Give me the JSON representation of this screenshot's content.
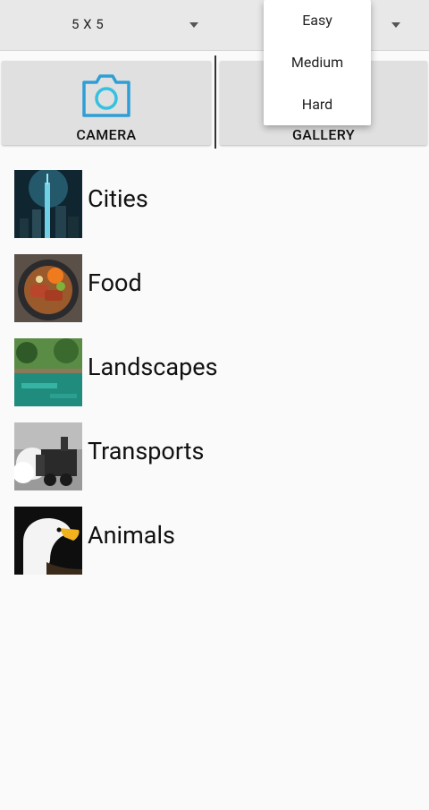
{
  "toolbar": {
    "grid_size_value": "5 X 5"
  },
  "difficulty_menu": {
    "options": [
      "Easy",
      "Medium",
      "Hard"
    ]
  },
  "buttons": {
    "camera_label": "CAMERA",
    "gallery_label": "GALLERY"
  },
  "categories": [
    {
      "label": "Cities",
      "thumb": "cities-thumbnail"
    },
    {
      "label": "Food",
      "thumb": "food-thumbnail"
    },
    {
      "label": "Landscapes",
      "thumb": "landscapes-thumbnail"
    },
    {
      "label": "Transports",
      "thumb": "transports-thumbnail"
    },
    {
      "label": "Animals",
      "thumb": "animals-thumbnail"
    }
  ],
  "colors": {
    "accent": "#2f9ed6",
    "toolbar_bg": "#e8e8e8",
    "tile_bg": "#e0e0e0"
  }
}
